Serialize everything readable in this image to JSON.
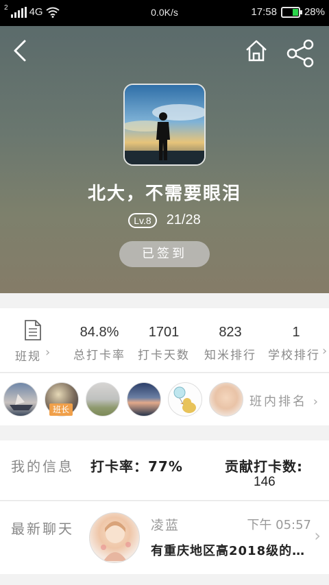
{
  "status_bar": {
    "sim_label": "2",
    "network": "4G",
    "speed": "0.0K/s",
    "time": "17:58",
    "battery": "28%"
  },
  "header": {
    "group_name": "北大，不需要眼泪",
    "level_badge": "Lv.8",
    "progress": "21/28",
    "signed_button": "已签到"
  },
  "stats": {
    "rules_label": "班规",
    "items": [
      {
        "value": "84.8%",
        "label": "总打卡率"
      },
      {
        "value": "1701",
        "label": "打卡天数"
      },
      {
        "value": "823",
        "label": "知米排行"
      },
      {
        "value": "1",
        "label": "学校排行"
      }
    ]
  },
  "members": {
    "monitor_tag": "班长",
    "rank_link": "班内排名"
  },
  "my_info": {
    "label": "我的信息",
    "rate": "打卡率：77%",
    "contribution_label": "贡献打卡数:",
    "contribution_value": "146"
  },
  "chat": {
    "label": "最新聊天",
    "sender": "凌蓝",
    "time": "下午 05:57",
    "message": "有重庆地区高2018级的…"
  },
  "colors": {
    "battery_fill": "#2bd44b",
    "monitor_tag": "#f0a04a"
  }
}
